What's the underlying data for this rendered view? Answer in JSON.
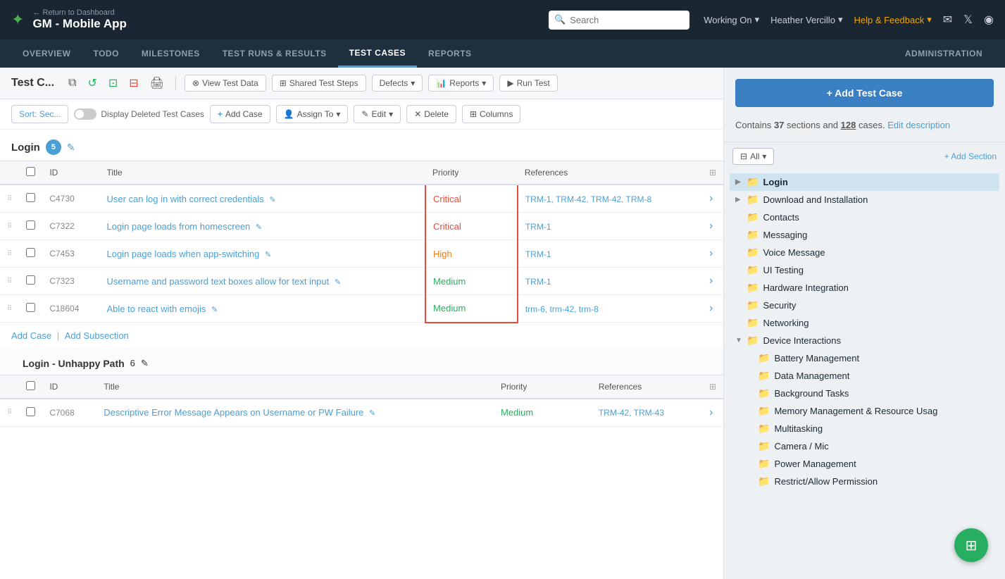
{
  "app": {
    "logo_icon": "✦",
    "back_label": "← Return to Dashboard",
    "project_title": "GM - Mobile App"
  },
  "top_nav": {
    "search_placeholder": "Search",
    "working_on": "Working On",
    "user": "Heather Vercillo",
    "help": "Help & Feedback"
  },
  "sub_nav": {
    "items": [
      {
        "id": "overview",
        "label": "OVERVIEW"
      },
      {
        "id": "todo",
        "label": "TODO"
      },
      {
        "id": "milestones",
        "label": "MILESTONES"
      },
      {
        "id": "test-runs",
        "label": "TEST RUNS & RESULTS"
      },
      {
        "id": "test-cases",
        "label": "TEST CASES",
        "active": true
      },
      {
        "id": "reports",
        "label": "REPORTS"
      }
    ],
    "admin_label": "ADMINISTRATION"
  },
  "toolbar": {
    "title": "Test C...",
    "view_test_data": "View Test Data",
    "shared_test_steps": "Shared Test Steps",
    "defects": "Defects",
    "reports": "Reports",
    "run_test": "Run Test"
  },
  "filter_bar": {
    "sort_label": "Sort:",
    "sort_value": "Sec...",
    "toggle_label": "Display Deleted Test Cases",
    "add_case": "+ Add Case",
    "assign_to": "Assign To",
    "edit": "Edit",
    "delete": "Delete",
    "columns": "Columns"
  },
  "section1": {
    "name": "Login",
    "count": 5,
    "columns": [
      "",
      "",
      "ID",
      "Title",
      "Priority",
      "References",
      ""
    ],
    "rows": [
      {
        "id": "C4730",
        "title": "User can log in with correct credentials",
        "priority": "Critical",
        "priority_class": "priority-critical",
        "references": "TRM-1, TRM-42, TRM-42, TRM-8",
        "highlighted": true
      },
      {
        "id": "C7322",
        "title": "Login page loads from homescreen",
        "priority": "Critical",
        "priority_class": "priority-critical",
        "references": "TRM-1",
        "highlighted": true
      },
      {
        "id": "C7453",
        "title": "Login page loads when app-switching",
        "priority": "High",
        "priority_class": "priority-high",
        "references": "TRM-1",
        "highlighted": true
      },
      {
        "id": "C7323",
        "title": "Username and password text boxes allow for text input",
        "priority": "Medium",
        "priority_class": "priority-medium",
        "references": "TRM-1",
        "highlighted": true
      },
      {
        "id": "C18604",
        "title": "Able to react with emojis",
        "priority": "Medium",
        "priority_class": "priority-medium",
        "references": "trm-6, trm-42, trm-8",
        "highlighted": true
      }
    ],
    "add_case": "Add Case",
    "add_subsection": "Add Subsection"
  },
  "section2": {
    "name": "Login - Unhappy Path",
    "count": 6,
    "columns": [
      "",
      "",
      "ID",
      "Title",
      "Priority",
      "References",
      ""
    ],
    "rows": [
      {
        "id": "C7068",
        "title": "Descriptive Error Message Appears on Username or PW Failure",
        "priority": "Medium",
        "priority_class": "priority-medium",
        "references": "TRM-42, TRM-43"
      }
    ]
  },
  "sidebar": {
    "add_test_case": "+ Add Test Case",
    "info_text_1": "Contains",
    "sections_count": "37",
    "info_text_2": "sections and",
    "cases_count": "128",
    "info_text_3": "cases.",
    "edit_description": "Edit description",
    "filter_label": "All",
    "add_section": "+ Add Section",
    "tree": [
      {
        "id": "login",
        "label": "Login",
        "level": 0,
        "expanded": false,
        "active": true
      },
      {
        "id": "download",
        "label": "Download and Installation",
        "level": 0,
        "expanded": false
      },
      {
        "id": "contacts",
        "label": "Contacts",
        "level": 0
      },
      {
        "id": "messaging",
        "label": "Messaging",
        "level": 0
      },
      {
        "id": "voice",
        "label": "Voice Message",
        "level": 0
      },
      {
        "id": "ui-testing",
        "label": "UI Testing",
        "level": 0
      },
      {
        "id": "hardware",
        "label": "Hardware Integration",
        "level": 0
      },
      {
        "id": "security",
        "label": "Security",
        "level": 0
      },
      {
        "id": "networking",
        "label": "Networking",
        "level": 0
      },
      {
        "id": "device",
        "label": "Device Interactions",
        "level": 0,
        "expanded": true
      },
      {
        "id": "battery",
        "label": "Battery Management",
        "level": 1
      },
      {
        "id": "data-mgmt",
        "label": "Data Management",
        "level": 1
      },
      {
        "id": "background",
        "label": "Background Tasks",
        "level": 1
      },
      {
        "id": "memory",
        "label": "Memory Management & Resource Usag",
        "level": 1
      },
      {
        "id": "multitasking",
        "label": "Multitasking",
        "level": 1
      },
      {
        "id": "camera",
        "label": "Camera / Mic",
        "level": 1
      },
      {
        "id": "power",
        "label": "Power Management",
        "level": 1
      },
      {
        "id": "restrict",
        "label": "Restrict/Allow Permission",
        "level": 1
      }
    ]
  },
  "float_btn": {
    "icon": "⊞"
  }
}
